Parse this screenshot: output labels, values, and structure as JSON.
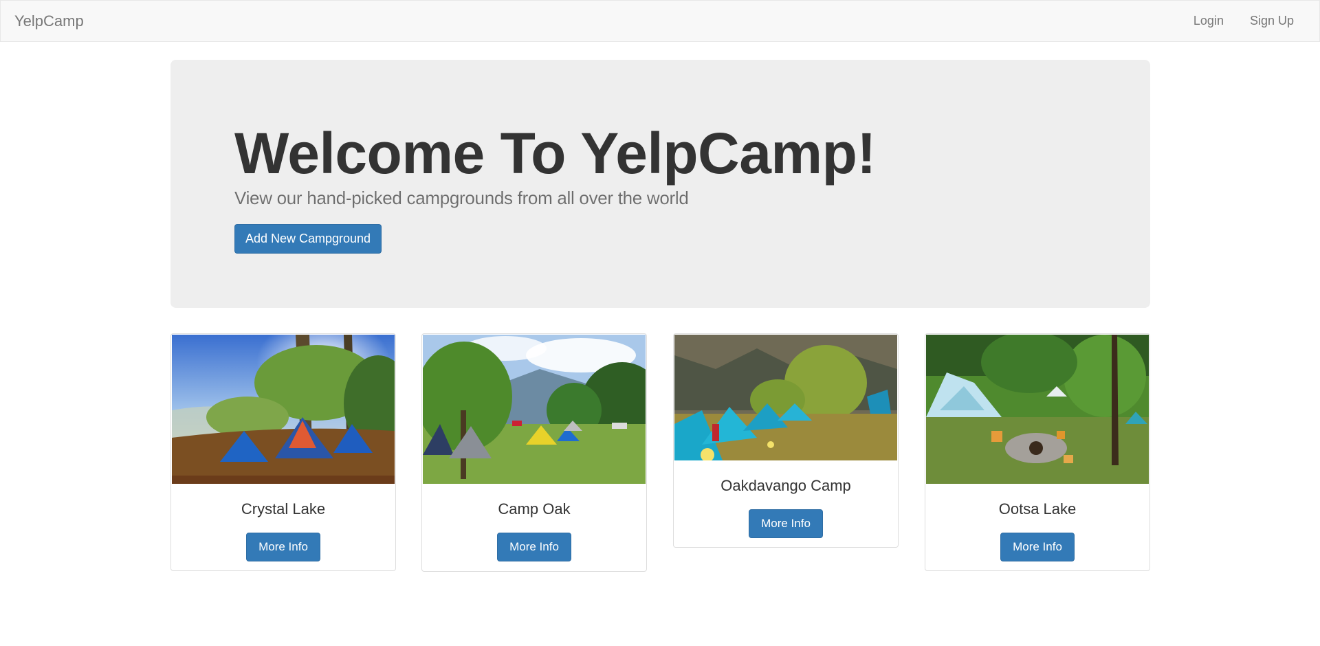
{
  "navbar": {
    "brand": "YelpCamp",
    "links": [
      "Login",
      "Sign Up"
    ]
  },
  "hero": {
    "title": "Welcome To YelpCamp!",
    "subtitle": "View our hand-picked campgrounds from all over the world",
    "button_label": "Add New Campground"
  },
  "campgrounds": [
    {
      "name": "Crystal Lake",
      "button_label": "More Info"
    },
    {
      "name": "Camp Oak",
      "button_label": "More Info"
    },
    {
      "name": "Oakdavango Camp",
      "button_label": "More Info"
    },
    {
      "name": "Ootsa Lake",
      "button_label": "More Info"
    }
  ],
  "colors": {
    "primary": "#337ab7",
    "navbar_bg": "#f8f8f8",
    "jumbotron_bg": "#eeeeee"
  }
}
